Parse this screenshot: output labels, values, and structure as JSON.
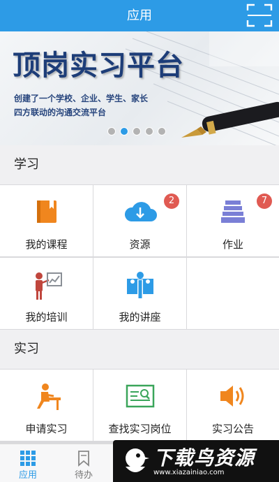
{
  "header": {
    "title": "应用",
    "scan_icon": "scan-frame-icon"
  },
  "banner": {
    "title": "顶岗实习平台",
    "subtitle_line1": "创建了一个学校、企业、学生、家长",
    "subtitle_line2": "四方联动的沟通交流平台",
    "slides_total": 5,
    "slide_active_index": 1
  },
  "sections": {
    "study": {
      "title": "学习",
      "items": [
        {
          "label": "我的课程",
          "icon": "book-icon",
          "badge": ""
        },
        {
          "label": "资源",
          "icon": "cloud-download-icon",
          "badge": "2"
        },
        {
          "label": "作业",
          "icon": "stacked-papers-icon",
          "badge": "7"
        },
        {
          "label": "我的培训",
          "icon": "trainer-board-icon",
          "badge": ""
        },
        {
          "label": "我的讲座",
          "icon": "lecture-people-icon",
          "badge": ""
        }
      ]
    },
    "internship": {
      "title": "实习",
      "items": [
        {
          "label": "申请实习",
          "icon": "person-desk-icon"
        },
        {
          "label": "查找实习岗位",
          "icon": "search-card-icon"
        },
        {
          "label": "实习公告",
          "icon": "speaker-icon"
        }
      ]
    }
  },
  "tabbar": {
    "tabs": [
      {
        "label": "应用",
        "icon": "grid-icon",
        "active": true
      },
      {
        "label": "待办",
        "icon": "bookmark-icon",
        "active": false
      }
    ]
  },
  "watermark": {
    "title": "下载鸟资源",
    "url": "www.xiazainiao.com"
  },
  "colors": {
    "primary": "#2d9be6",
    "badge": "#e05a52",
    "orange": "#f0861e",
    "green": "#3aa55a",
    "purple": "#7a7fd6"
  }
}
